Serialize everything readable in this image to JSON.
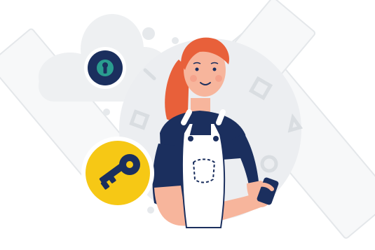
{
  "illustration": {
    "subject": "woman-holding-phone",
    "icons": [
      "keyhole-icon",
      "key-icon",
      "phone-icon"
    ],
    "colors": {
      "background": "#ffffff",
      "frame_fill": "#f7f8f9",
      "frame_stroke": "#e4e7ea",
      "cloud": "#eef0f2",
      "circle_bg": "#eceef1",
      "navy": "#1b2f5e",
      "teal": "#2a9d8f",
      "yellow": "#f6c815",
      "hair": "#e8603a",
      "skin": "#f7b59c",
      "overalls": "#ffffff"
    }
  }
}
